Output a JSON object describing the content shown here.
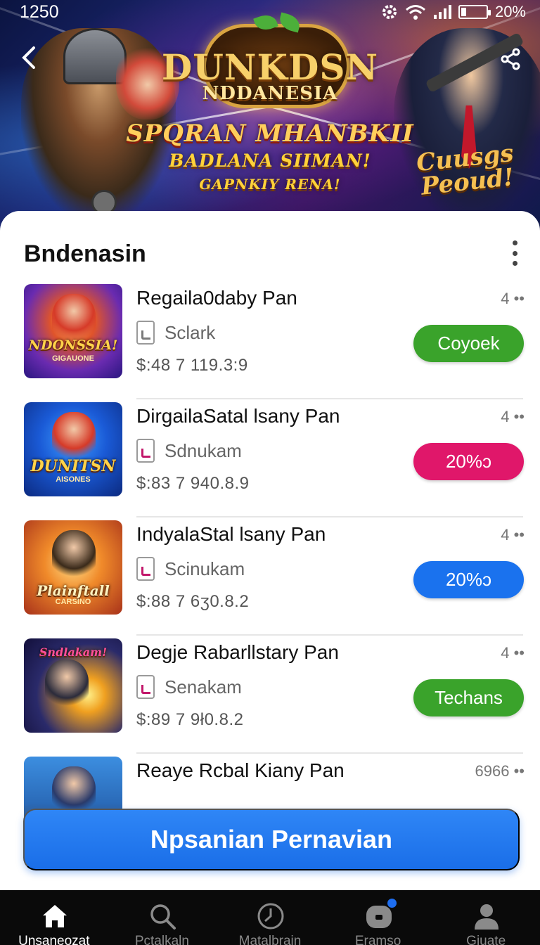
{
  "status_bar": {
    "time": "1250",
    "battery_text": "20%",
    "battery_level": 0.2
  },
  "hero": {
    "logo_line1": "DUNKDSN",
    "logo_line2": "NDDANESIA",
    "headline": "SPQRAN MHANBKII",
    "subline1": "BADLANA SIIMAN!",
    "subline2": "GAPNKIY RENA!",
    "side_text": "Cuusgs Peoud!"
  },
  "section": {
    "title": "Bndenasin"
  },
  "games": [
    {
      "name": "Regaila0daby Pan",
      "publisher": "Sclark",
      "price": "$:48 7 119.3:9",
      "rating": "4 ••",
      "action_label": "Coyoek",
      "action_color": "#3aa32b",
      "thumb_text": "NDONSSIA!",
      "thumb_sub": "GIGAUONE",
      "doc_icon_color": "#7a7a7a"
    },
    {
      "name": "DirgailaSatal lsany Pan",
      "publisher": "Sdnukam",
      "price": "$:83 7 940.8.9",
      "rating": "4 ••",
      "action_label": "20%ɔ",
      "action_color": "#e0176a",
      "thumb_text": "DUNITSN",
      "thumb_sub": "AISONES",
      "doc_icon_color": "#c2186b"
    },
    {
      "name": "IndyalaStal lsany Pan",
      "publisher": "Scinukam",
      "price": "$:88 7 6ʒ0.8.2",
      "rating": "4 ••",
      "action_label": "20%ɔ",
      "action_color": "#1a72ee",
      "thumb_text": "Plainftall",
      "thumb_sub": "CARSINO",
      "doc_icon_color": "#c2186b"
    },
    {
      "name": "Degje Rabarllstary Pan",
      "publisher": "Senakam",
      "price": "$:89 7 9ł0.8.2",
      "rating": "4 ••",
      "action_label": "Techans",
      "action_color": "#3aa32b",
      "thumb_text": "Sndlakam!",
      "thumb_sub": "",
      "doc_icon_color": "#c2186b"
    },
    {
      "name": "Reaye Rcbal Kiany Pan",
      "publisher": "",
      "price": "",
      "rating": "6966 ••",
      "action_label": "",
      "action_color": "",
      "thumb_text": "",
      "thumb_sub": "",
      "doc_icon_color": "#c2186b"
    }
  ],
  "cta": {
    "label": "Npsanian Pernavian"
  },
  "nav": [
    {
      "label": "Unsaneozat",
      "icon": "home-icon",
      "active": true
    },
    {
      "label": "Pctalkaln",
      "icon": "search-icon",
      "active": false
    },
    {
      "label": "Matalbrain",
      "icon": "clock-icon",
      "active": false
    },
    {
      "label": "Eramso",
      "icon": "gamepad-icon",
      "active": false
    },
    {
      "label": "Giuate",
      "icon": "profile-icon",
      "active": false
    }
  ],
  "colors": {
    "cta": "#1f74ee",
    "accent_blue": "#1e6ef0",
    "nav_bg": "#0a0a0a"
  }
}
